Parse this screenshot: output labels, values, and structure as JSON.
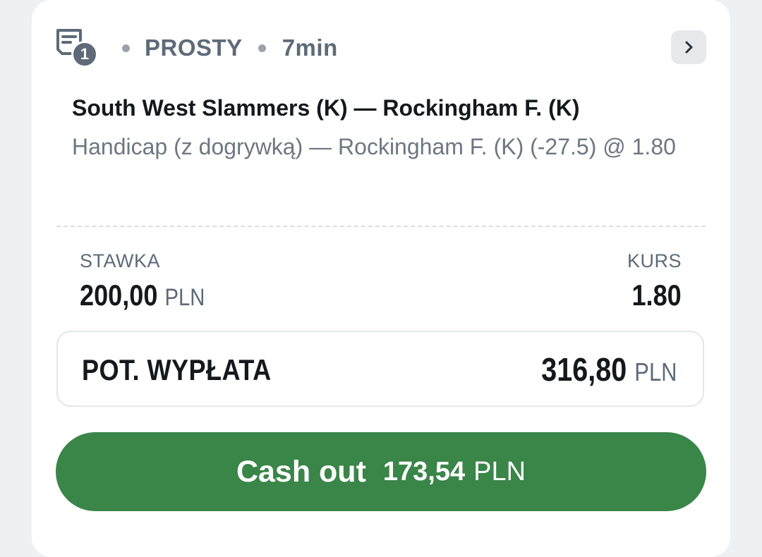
{
  "header": {
    "bet_count": "1",
    "bet_type": "PROSTY",
    "time_ago": "7min",
    "icon": "bet-slip-icon",
    "nav_icon": "chevron-right-icon"
  },
  "selection": {
    "match": "South West Slammers (K) — Rockingham F. (K)",
    "market": "Handicap (z dogrywką) — Rockingham F. (K) (-27.5) @ 1.80"
  },
  "stake": {
    "label": "STAWKA",
    "value": "200,00",
    "currency": "PLN"
  },
  "odds": {
    "label": "KURS",
    "value": "1.80"
  },
  "payout": {
    "label": "POT. WYPŁATA",
    "value": "316,80",
    "currency": "PLN"
  },
  "cashout": {
    "label": "Cash out",
    "amount": "173,54",
    "currency": "PLN"
  },
  "colors": {
    "accent_green": "#3a8548",
    "text_muted": "#5e6a78",
    "text_primary": "#15181c",
    "background": "#eef0f2"
  }
}
